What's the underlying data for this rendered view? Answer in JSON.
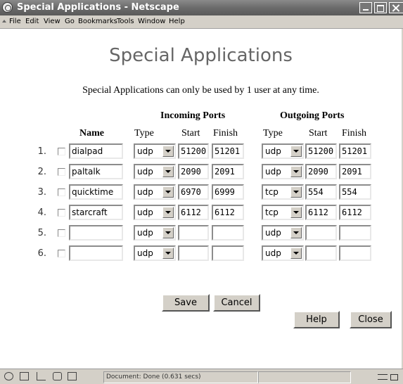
{
  "window": {
    "title": "Special Applications - Netscape"
  },
  "menu": {
    "items": [
      "File",
      "Edit",
      "View",
      "Go",
      "Bookmarks",
      "Tools",
      "Window",
      "Help"
    ]
  },
  "page": {
    "title": "Special Applications",
    "notice": "Special Applications can only be used by 1 user at any time."
  },
  "table": {
    "incoming_header": "Incoming Ports",
    "outgoing_header": "Outgoing Ports",
    "col_name": "Name",
    "col_type": "Type",
    "col_start": "Start",
    "col_finish": "Finish",
    "rows": [
      {
        "num": "1.",
        "name": "dialpad",
        "in_type": "udp",
        "in_start": "51200",
        "in_finish": "51201",
        "out_type": "udp",
        "out_start": "51200",
        "out_finish": "51201"
      },
      {
        "num": "2.",
        "name": "paltalk",
        "in_type": "udp",
        "in_start": "2090",
        "in_finish": "2091",
        "out_type": "udp",
        "out_start": "2090",
        "out_finish": "2091"
      },
      {
        "num": "3.",
        "name": "quicktime",
        "in_type": "udp",
        "in_start": "6970",
        "in_finish": "6999",
        "out_type": "tcp",
        "out_start": "554",
        "out_finish": "554"
      },
      {
        "num": "4.",
        "name": "starcraft",
        "in_type": "udp",
        "in_start": "6112",
        "in_finish": "6112",
        "out_type": "tcp",
        "out_start": "6112",
        "out_finish": "6112"
      },
      {
        "num": "5.",
        "name": "",
        "in_type": "udp",
        "in_start": "",
        "in_finish": "",
        "out_type": "udp",
        "out_start": "",
        "out_finish": ""
      },
      {
        "num": "6.",
        "name": "",
        "in_type": "udp",
        "in_start": "",
        "in_finish": "",
        "out_type": "udp",
        "out_start": "",
        "out_finish": ""
      }
    ]
  },
  "buttons": {
    "save": "Save",
    "cancel": "Cancel",
    "help": "Help",
    "close": "Close"
  },
  "status": {
    "text": "Document: Done (0.631 secs)"
  }
}
